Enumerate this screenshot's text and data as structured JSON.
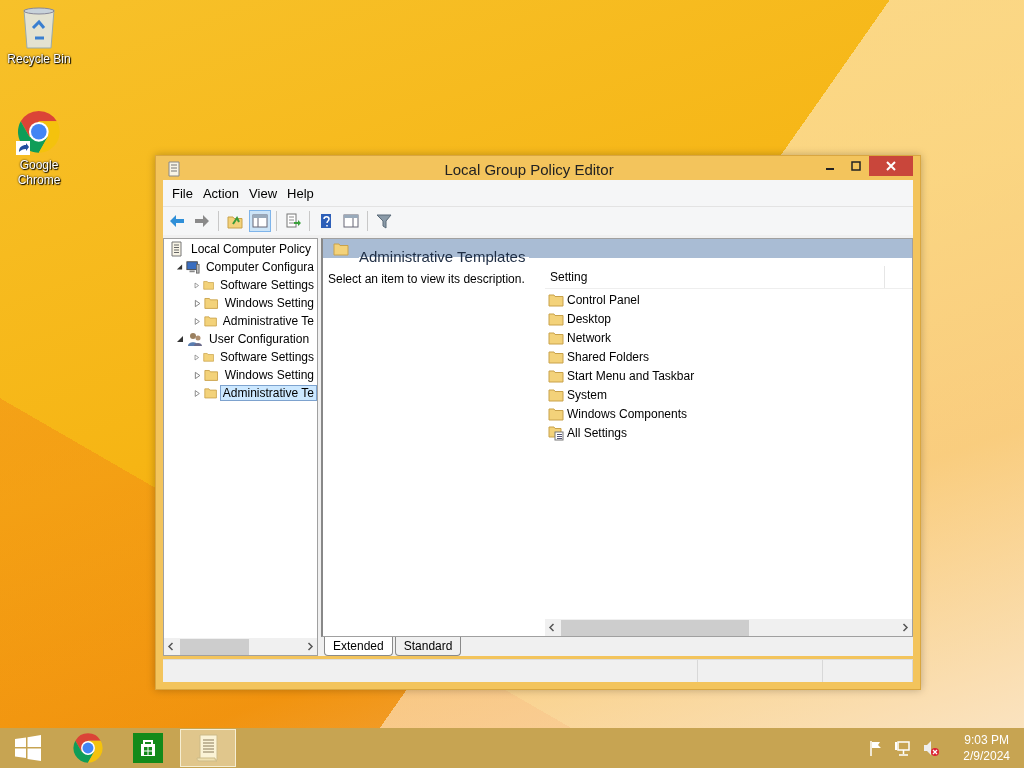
{
  "desktop_icons": [
    {
      "kind": "recycle",
      "label": "Recycle Bin"
    },
    {
      "kind": "chrome",
      "label": "Google Chrome"
    }
  ],
  "window": {
    "title": "Local Group Policy Editor",
    "menu": [
      "File",
      "Action",
      "View",
      "Help"
    ],
    "toolbar": [
      [
        {
          "kind": "back",
          "pressed": false
        },
        {
          "kind": "forward",
          "pressed": false
        }
      ],
      [
        {
          "kind": "up",
          "pressed": false
        },
        {
          "kind": "tree",
          "pressed": true
        }
      ],
      [
        {
          "kind": "export",
          "pressed": false
        }
      ],
      [
        {
          "kind": "help",
          "pressed": false
        },
        {
          "kind": "pane",
          "pressed": false
        }
      ],
      [
        {
          "kind": "filter",
          "pressed": false
        }
      ]
    ],
    "tree": {
      "label": "Local Computer Policy",
      "kind": "policy",
      "children": [
        {
          "label": "Computer Configura",
          "kind": "computer",
          "expanded": true,
          "selected": false,
          "children": [
            {
              "label": "Software Settings",
              "kind": "folder",
              "expanded": false,
              "selected": false
            },
            {
              "label": "Windows Setting",
              "kind": "folder",
              "expanded": false,
              "selected": false
            },
            {
              "label": "Administrative Te",
              "kind": "folder",
              "expanded": false,
              "selected": false
            }
          ]
        },
        {
          "label": "User Configuration",
          "kind": "user",
          "expanded": true,
          "selected": false,
          "children": [
            {
              "label": "Software Settings",
              "kind": "folder",
              "expanded": false,
              "selected": false
            },
            {
              "label": "Windows Setting",
              "kind": "folder",
              "expanded": false,
              "selected": false
            },
            {
              "label": "Administrative Te",
              "kind": "folder",
              "expanded": false,
              "selected": true
            }
          ]
        }
      ]
    },
    "details": {
      "header": "Administrative Templates",
      "description": "Select an item to view its description.",
      "column": "Setting",
      "items": [
        {
          "kind": "folder",
          "label": "Control Panel"
        },
        {
          "kind": "folder",
          "label": "Desktop"
        },
        {
          "kind": "folder",
          "label": "Network"
        },
        {
          "kind": "folder",
          "label": "Shared Folders"
        },
        {
          "kind": "folder",
          "label": "Start Menu and Taskbar"
        },
        {
          "kind": "folder",
          "label": "System"
        },
        {
          "kind": "folder",
          "label": "Windows Components"
        },
        {
          "kind": "settings",
          "label": "All Settings"
        }
      ]
    },
    "tabs": [
      {
        "label": "Extended",
        "selected": true
      },
      {
        "label": "Standard",
        "selected": false
      }
    ]
  },
  "taskbar": {
    "items": [
      {
        "kind": "start",
        "active": false
      },
      {
        "kind": "chrome",
        "active": false
      },
      {
        "kind": "store",
        "active": false
      },
      {
        "kind": "gpedit",
        "active": true
      }
    ],
    "tray": [
      {
        "kind": "flag"
      },
      {
        "kind": "network"
      },
      {
        "kind": "volume-muted"
      }
    ],
    "time": "9:03 PM",
    "date": "2/9/2024"
  }
}
